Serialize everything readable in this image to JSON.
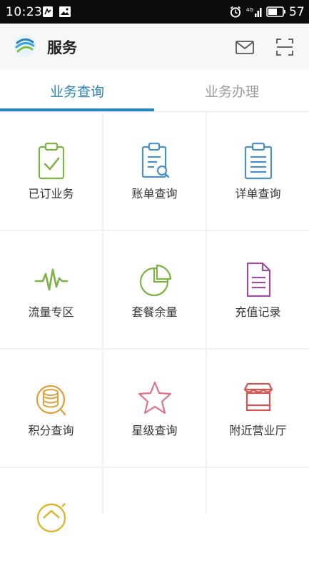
{
  "status_bar": {
    "time": "10:23",
    "battery": "57"
  },
  "header": {
    "title": "服务"
  },
  "tabs": [
    {
      "label": "业务查询",
      "active": true
    },
    {
      "label": "业务办理",
      "active": false
    }
  ],
  "services": [
    {
      "label": "已订业务",
      "icon": "clipboard-check-icon",
      "color": "#7cb342"
    },
    {
      "label": "账单查询",
      "icon": "bill-search-icon",
      "color": "#4a90c8"
    },
    {
      "label": "详单查询",
      "icon": "detail-list-icon",
      "color": "#4a90c8"
    },
    {
      "label": "流量专区",
      "icon": "pulse-wave-icon",
      "color": "#7cb342"
    },
    {
      "label": "套餐余量",
      "icon": "pie-chart-icon",
      "color": "#7cb342"
    },
    {
      "label": "充值记录",
      "icon": "document-icon",
      "color": "#9c4f9c"
    },
    {
      "label": "积分查询",
      "icon": "coin-stack-icon",
      "color": "#e0a03a"
    },
    {
      "label": "星级查询",
      "icon": "star-icon",
      "color": "#e0708a"
    },
    {
      "label": "附近营业厅",
      "icon": "store-icon",
      "color": "#d9534f"
    },
    {
      "label": "",
      "icon": "home-refresh-icon",
      "color": "#e0b020"
    }
  ],
  "colors": {
    "accent": "#2a84c4",
    "header_bg": "#f7f7f7",
    "grid_gap": "#f2f2f2"
  }
}
